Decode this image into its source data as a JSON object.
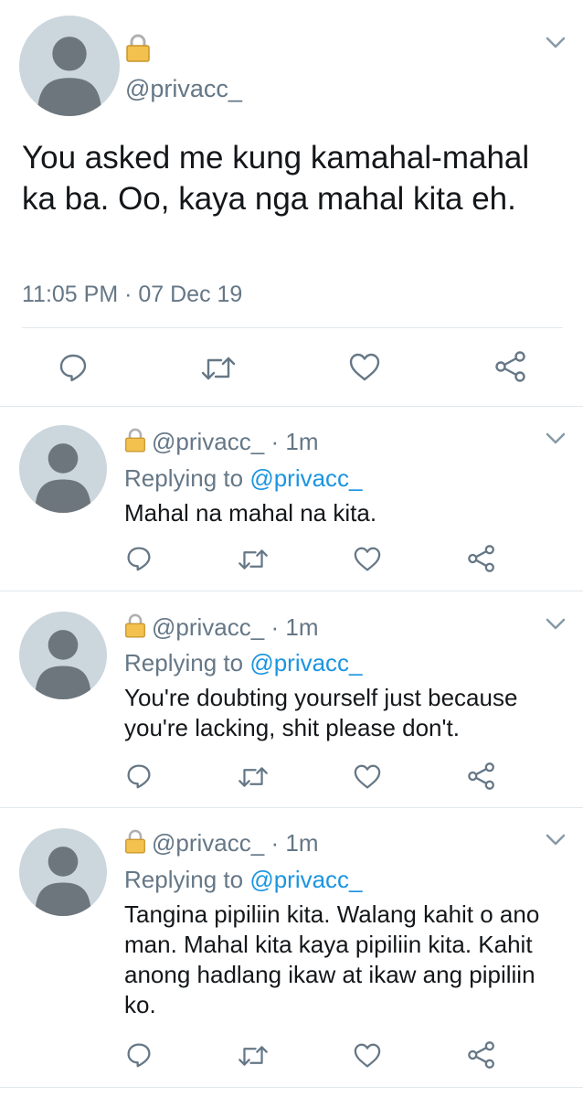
{
  "colors": {
    "text": "#14171a",
    "secondary": "#657786",
    "link": "#1b95e0",
    "divider": "#e1e8ed",
    "avatar_bg": "#ccd6dd",
    "avatar_fg": "#6e767d"
  },
  "main_tweet": {
    "handle": "@privacc_",
    "text": "You asked me kung kamahal-mahal ka ba. Oo, kaya nga mahal kita eh.",
    "timestamp": "11:05 PM · 07 Dec 19",
    "actions": [
      "reply-icon",
      "retweet-icon",
      "like-icon",
      "share-icon"
    ]
  },
  "replies": [
    {
      "handle": "@privacc_",
      "separator": "·",
      "time": "1m",
      "replying_prefix": "Replying to",
      "replying_to": "@privacc_",
      "text": "Mahal na mahal na kita."
    },
    {
      "handle": "@privacc_",
      "separator": "·",
      "time": "1m",
      "replying_prefix": "Replying to",
      "replying_to": "@privacc_",
      "text": "You're doubting yourself just because you're lacking, shit please don't."
    },
    {
      "handle": "@privacc_",
      "separator": "·",
      "time": "1m",
      "replying_prefix": "Replying to",
      "replying_to": "@privacc_",
      "text": "Tangina pipiliin kita. Walang kahit o ano man. Mahal kita kaya pipiliin kita. Kahit anong hadlang ikaw at ikaw ang pipiliin ko."
    }
  ]
}
